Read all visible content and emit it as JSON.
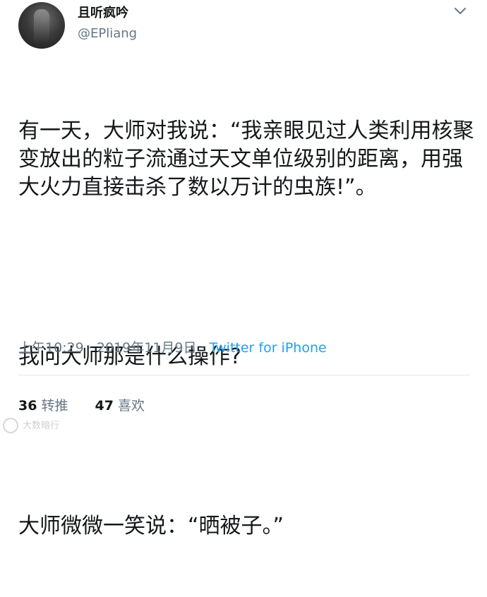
{
  "author": {
    "display_name": "且听疯吟",
    "handle": "@EPliang",
    "avatar_icon": "avatar-photo"
  },
  "menu": {
    "icon": "chevron-down-icon"
  },
  "tweet": {
    "paragraphs": [
      "有一天，大师对我说：“我亲眼见过人类利用核聚变放出的粒子流通过天文单位级别的距离，用强大火力直接击杀了数以万计的虫族!”。",
      "我问大师那是什么操作?",
      "大师微微一笑说：“晒被子。”"
    ],
    "time": "上午10:29",
    "date": "2019年11月9日",
    "separator": "·",
    "source": "Twitter for iPhone"
  },
  "stats": {
    "retweets_count": "36",
    "retweets_label": "转推",
    "likes_count": "47",
    "likes_label": "喜欢"
  },
  "colors": {
    "link": "#1da1f2",
    "secondary_text": "#657786",
    "primary_text": "#14171a",
    "divider": "#e1e8ed"
  },
  "watermark": {
    "text": "大数暗行"
  }
}
